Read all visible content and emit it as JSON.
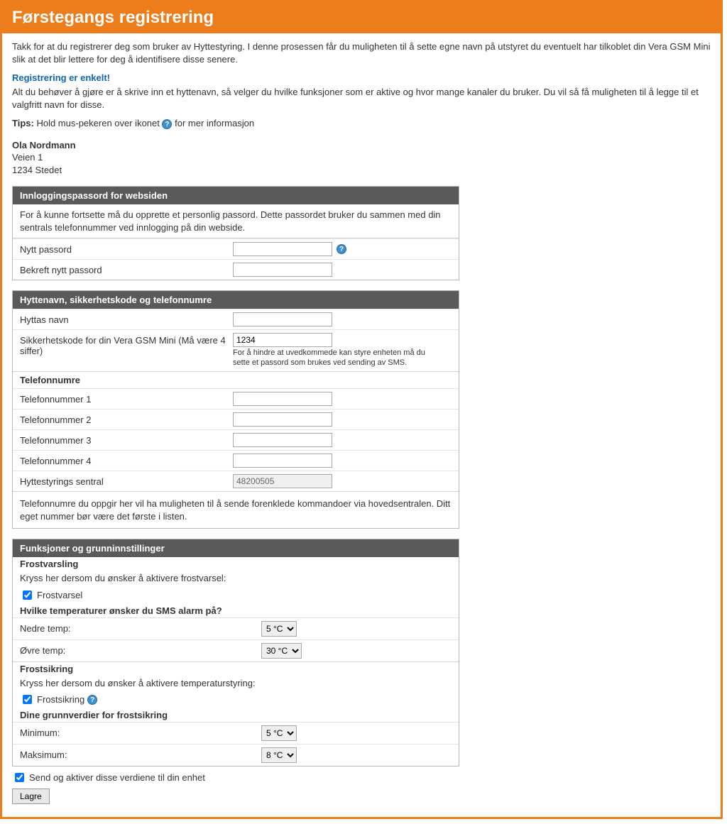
{
  "header": {
    "title": "Førstegangs registrering"
  },
  "intro": {
    "p1": "Takk for at du registrerer deg som bruker av Hyttestyring. I denne prosessen får du muligheten til å sette egne navn på utstyret du eventuelt har tilkoblet din Vera GSM Mini slik at det blir lettere for deg å identifisere disse senere.",
    "subheading": "Registrering er enkelt!",
    "p2": "Alt du behøver å gjøre er å skrive inn et hyttenavn, så velger du hvilke funksjoner som er aktive og hvor mange kanaler du bruker. Du vil så få muligheten til å legge til et valgfritt navn for disse.",
    "tips_label": "Tips:",
    "tips_text_a": "Hold mus-pekeren over ikonet ",
    "tips_text_b": " for mer informasjon"
  },
  "user": {
    "name": "Ola Nordmann",
    "street": "Veien 1",
    "city": "1234 Stedet"
  },
  "panel_pw": {
    "title": "Innloggingspassord for websiden",
    "desc": "For å kunne fortsette må du opprette et personlig passord. Dette passordet bruker du sammen med din sentrals telefonnummer ved innlogging på din webside.",
    "new_label": "Nytt passord",
    "confirm_label": "Bekreft nytt passord"
  },
  "panel_cabin": {
    "title": "Hyttenavn, sikkerhetskode og telefonnumre",
    "name_label": "Hyttas navn",
    "sec_label": "Sikkerhetskode for din Vera GSM Mini (Må være 4 siffer)",
    "sec_value": "1234",
    "sec_hint": "For å hindre at uvedkommede kan styre enheten må du sette et passord som brukes ved sending av SMS.",
    "phones_heading": "Telefonnumre",
    "phone1": "Telefonnummer 1",
    "phone2": "Telefonnummer 2",
    "phone3": "Telefonnummer 3",
    "phone4": "Telefonnummer 4",
    "central_label": "Hyttestyrings sentral",
    "central_value": "48200505",
    "footer": "Telefonnumre du oppgir her vil ha muligheten til å sende forenklede kommandoer via hovedsentralen. Ditt eget nummer bør være det første i listen."
  },
  "panel_func": {
    "title": "Funksjoner og grunninnstillinger",
    "frost_heading": "Frostvarsling",
    "frost_desc": "Kryss her dersom du ønsker å aktivere frostvarsel:",
    "frost_check": "Frostvarsel",
    "temp_q": "Hvilke temperaturer ønsker du SMS alarm på?",
    "lower_label": "Nedre temp:",
    "lower_value": "5 °C",
    "upper_label": "Øvre temp:",
    "upper_value": "30 °C",
    "sikring_heading": "Frostsikring",
    "sikring_desc": "Kryss her dersom du ønsker å aktivere temperaturstyring:",
    "sikring_check": "Frostsikring",
    "grunn_heading": "Dine grunnverdier for frostsikring",
    "min_label": "Minimum:",
    "min_value": "5 °C",
    "max_label": "Maksimum:",
    "max_value": "8 °C"
  },
  "outside": {
    "send_label": "Send og aktiver disse verdiene til din enhet",
    "save": "Lagre"
  }
}
